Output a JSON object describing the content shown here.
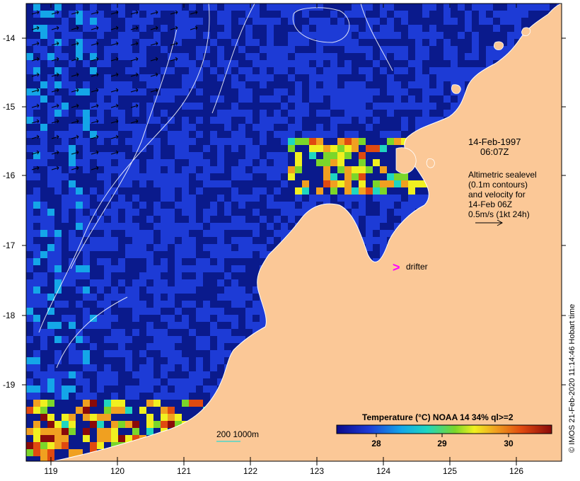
{
  "map": {
    "lon_ticks": [
      "119",
      "120",
      "121",
      "122",
      "123",
      "124",
      "125",
      "126"
    ],
    "lat_ticks": [
      "-14",
      "-15",
      "-16",
      "-17",
      "-18",
      "-19"
    ],
    "date_line1": "14-Feb-1997",
    "date_line2": "06:07Z",
    "legend_lines": [
      "Altimetric sealevel",
      "(0.1m contours)",
      "and velocity for",
      "14-Feb 06Z",
      "0.5m/s (1kt 24h)"
    ],
    "drifter_symbol": ">",
    "drifter_label": "drifter",
    "depth_contour_label": "200  1000m",
    "copyright": "© IMOS 21-Feb-2020 11:14:46 Hobart time",
    "colorbar_title": "Temperature (°C) NOAA 14 34% ql>=2",
    "colorbar_ticks": [
      "28",
      "29",
      "30"
    ],
    "colors": {
      "land": "#fbc897",
      "ocean_dark": "#0a1a8c",
      "drifter": "#ff00ff",
      "contour": "#ffffff",
      "depth_contour": "#4fd6c8"
    }
  }
}
